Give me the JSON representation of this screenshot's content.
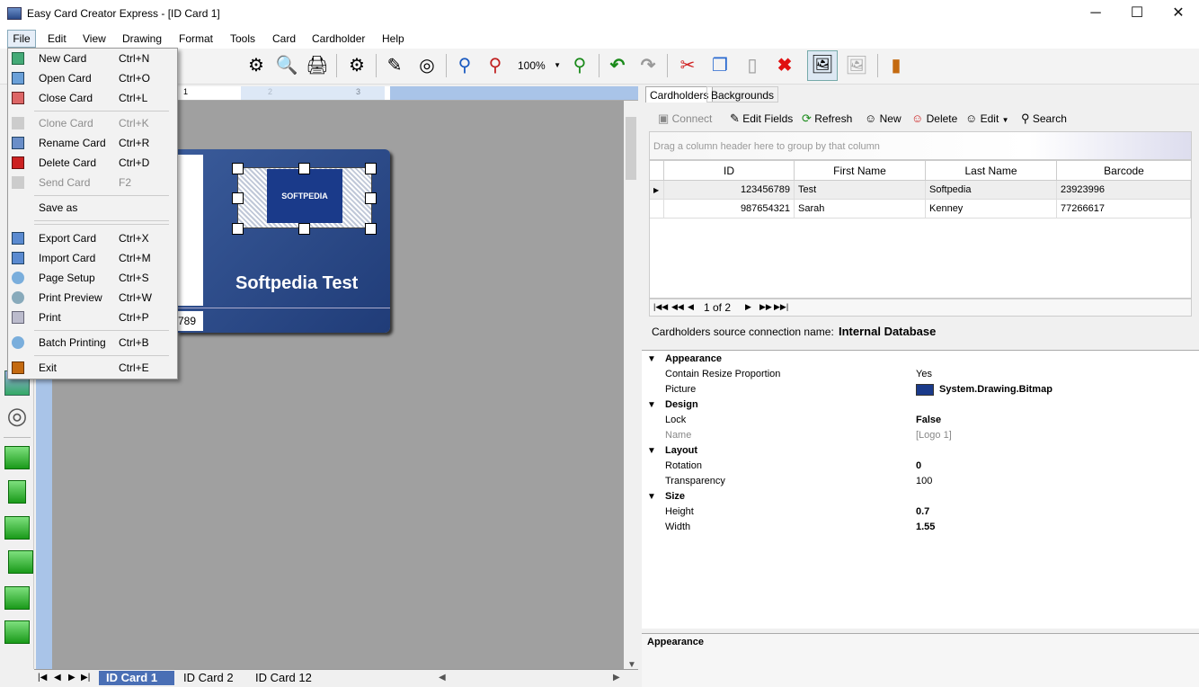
{
  "window": {
    "title": "Easy Card Creator Express - [ID Card 1]",
    "minimize": "─",
    "maximize": "☐",
    "close": "✕"
  },
  "menubar": [
    "File",
    "Edit",
    "View",
    "Drawing",
    "Format",
    "Tools",
    "Card",
    "Cardholder",
    "Help"
  ],
  "toolbar": {
    "zoom": "100%"
  },
  "file_menu": [
    {
      "label": "New Card",
      "shortcut": "Ctrl+N"
    },
    {
      "label": "Open Card",
      "shortcut": "Ctrl+O"
    },
    {
      "label": "Close Card",
      "shortcut": "Ctrl+L"
    },
    {
      "label": "Clone Card",
      "shortcut": "Ctrl+K"
    },
    {
      "label": "Rename Card",
      "shortcut": "Ctrl+R"
    },
    {
      "label": "Delete Card",
      "shortcut": "Ctrl+D"
    },
    {
      "label": "Send Card",
      "shortcut": "F2"
    },
    {
      "label": "Save as",
      "shortcut": ""
    },
    {
      "label": "Export Card",
      "shortcut": "Ctrl+X"
    },
    {
      "label": "Import Card",
      "shortcut": "Ctrl+M"
    },
    {
      "label": "Page Setup",
      "shortcut": "Ctrl+S"
    },
    {
      "label": "Print Preview",
      "shortcut": "Ctrl+W"
    },
    {
      "label": "Print",
      "shortcut": "Ctrl+P"
    },
    {
      "label": "Batch Printing",
      "shortcut": "Ctrl+B"
    },
    {
      "label": "Exit",
      "shortcut": "Ctrl+E"
    }
  ],
  "card": {
    "name": "Softpedia Test",
    "id_fragment": "789",
    "logo_text": "SOFTPEDIA"
  },
  "sheet_tabs": [
    "ID Card 1",
    "ID Card 2",
    "ID Card 12"
  ],
  "right_tabs": [
    "Cardholders",
    "Backgrounds"
  ],
  "cardholder_toolbar": {
    "connect": "Connect",
    "edit_fields": "Edit Fields",
    "refresh": "Refresh",
    "new": "New",
    "delete": "Delete",
    "edit": "Edit",
    "search": "Search"
  },
  "grid": {
    "group_hint": "Drag a column header here to group by that column",
    "columns": [
      "ID",
      "First Name",
      "Last Name",
      "Barcode"
    ],
    "rows": [
      [
        "123456789",
        "Test",
        "Softpedia",
        "23923996"
      ],
      [
        "987654321",
        "Sarah",
        "Kenney",
        "77266617"
      ]
    ],
    "pager": "1 of 2"
  },
  "source": {
    "label": "Cardholders source connection name:",
    "value": "Internal Database"
  },
  "properties": {
    "appearance": "Appearance",
    "contain_resize_label": "Contain Resize Proportion",
    "contain_resize_value": "Yes",
    "picture_label": "Picture",
    "picture_value": "System.Drawing.Bitmap",
    "design": "Design",
    "lock_label": "Lock",
    "lock_value": "False",
    "name_label": "Name",
    "name_value": "[Logo 1]",
    "layout": "Layout",
    "rotation_label": "Rotation",
    "rotation_value": "0",
    "transparency_label": "Transparency",
    "transparency_value": "100",
    "size": "Size",
    "height_label": "Height",
    "height_value": "0.7",
    "width_label": "Width",
    "width_value": "1.55"
  },
  "description": {
    "title": "Appearance"
  },
  "colors": {
    "card_blue": "#2a4a88",
    "accent_blue": "#a9c4e8"
  }
}
